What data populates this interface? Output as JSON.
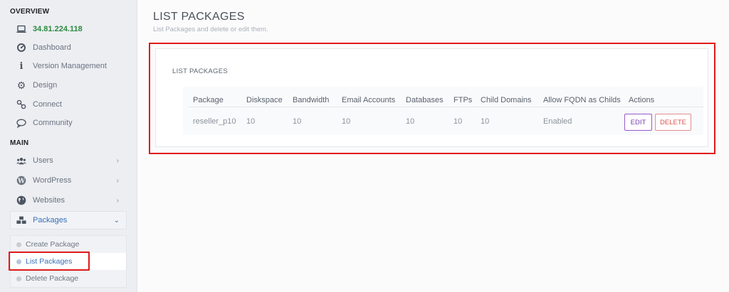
{
  "sidebar": {
    "overview_title": "OVERVIEW",
    "ip_address": "34.81.224.118",
    "overview_items": [
      {
        "label": "Dashboard",
        "icon": "dashboard-icon"
      },
      {
        "label": "Version Management",
        "icon": "info-icon"
      },
      {
        "label": "Design",
        "icon": "gear-icon"
      },
      {
        "label": "Connect",
        "icon": "link-icon"
      },
      {
        "label": "Community",
        "icon": "chat-icon"
      }
    ],
    "main_title": "MAIN",
    "main_items": [
      {
        "label": "Users",
        "icon": "users-icon"
      },
      {
        "label": "WordPress",
        "icon": "wordpress-icon"
      },
      {
        "label": "Websites",
        "icon": "globe-icon"
      },
      {
        "label": "Packages",
        "icon": "cubes-icon"
      }
    ],
    "package_subitems": [
      {
        "label": "Create Package",
        "active": false
      },
      {
        "label": "List Packages",
        "active": true
      },
      {
        "label": "Delete Package",
        "active": false
      }
    ]
  },
  "main": {
    "title": "LIST PACKAGES",
    "subtitle": "List Packages and delete or edit them.",
    "panel_title": "LIST PACKAGES",
    "table": {
      "columns": [
        "Package",
        "Diskspace",
        "Bandwidth",
        "Email Accounts",
        "Databases",
        "FTPs",
        "Child Domains",
        "Allow FQDN as Childs",
        "Actions"
      ],
      "rows": [
        [
          "reseller_p10",
          "10",
          "10",
          "10",
          "10",
          "10",
          "10",
          "Enabled"
        ]
      ],
      "edit_label": "EDIT",
      "delete_label": "DELETE"
    }
  },
  "colors": {
    "highlight": "#e01a1a",
    "ip_green": "#2d8a3f",
    "link_blue": "#3b6fb8",
    "edit_purple": "#7a3fb3",
    "delete_red": "#d9534f"
  }
}
